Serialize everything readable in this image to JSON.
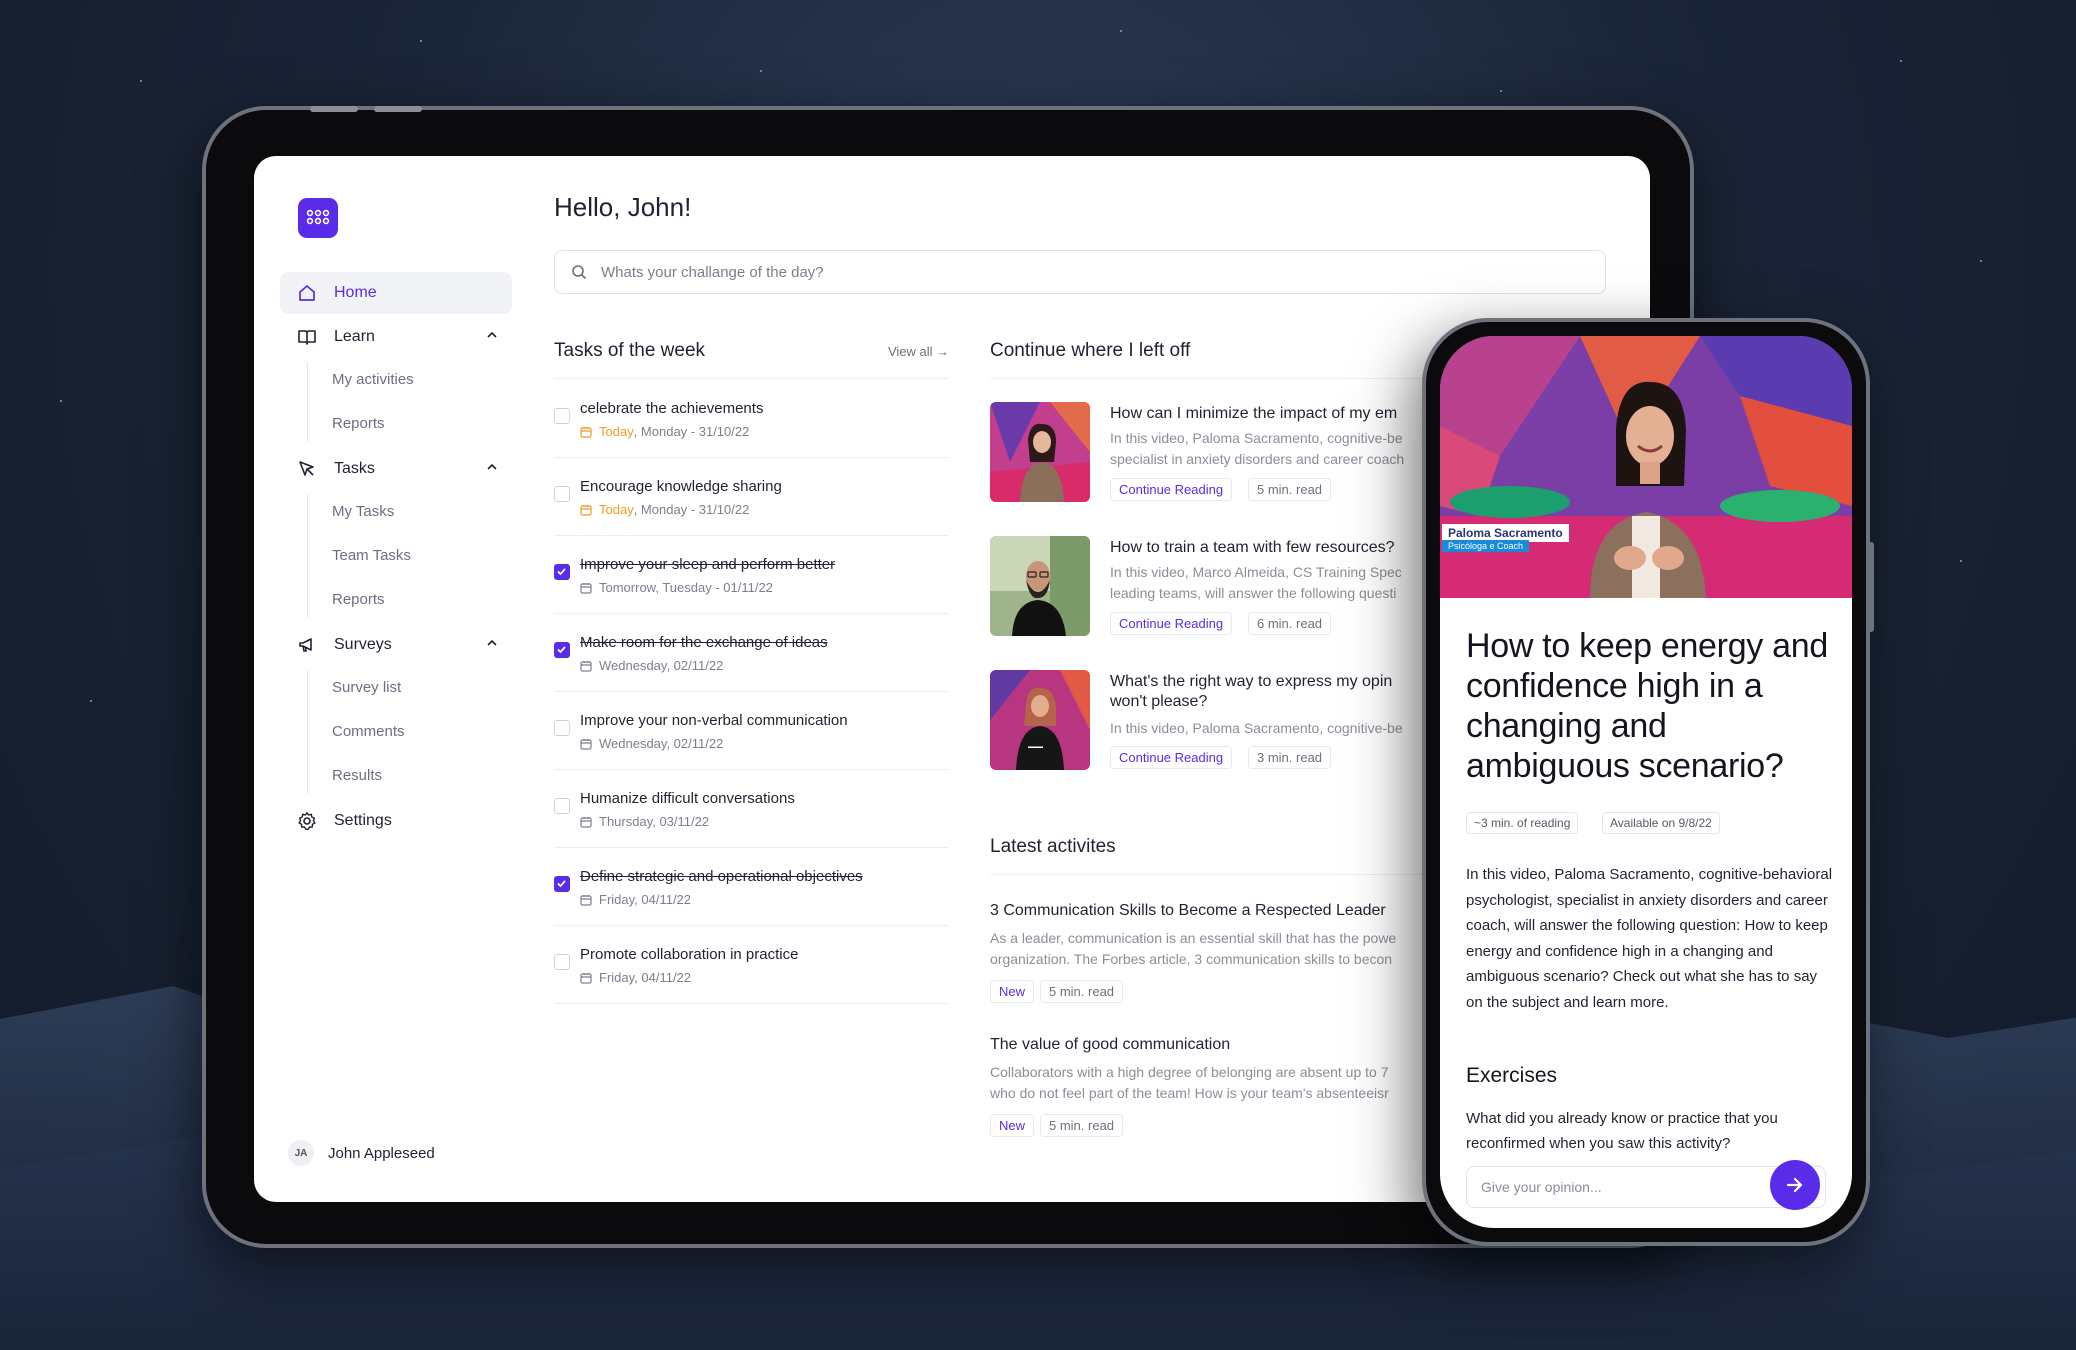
{
  "sidebar": {
    "items": [
      {
        "label": "Home",
        "icon": "home-icon"
      },
      {
        "label": "Learn",
        "icon": "book-icon",
        "sub": [
          "My activities",
          "Reports"
        ]
      },
      {
        "label": "Tasks",
        "icon": "cursor-icon",
        "sub": [
          "My Tasks",
          "Team Tasks",
          "Reports"
        ]
      },
      {
        "label": "Surveys",
        "icon": "megaphone-icon",
        "sub": [
          "Survey list",
          "Comments",
          "Results"
        ]
      },
      {
        "label": "Settings",
        "icon": "gear-icon"
      }
    ],
    "user": {
      "initials": "JA",
      "name": "John Appleseed"
    }
  },
  "header": {
    "greeting": "Hello, John!"
  },
  "search": {
    "placeholder": "Whats your challange of the day?"
  },
  "tasks": {
    "title": "Tasks of the week",
    "view_all": "View all →",
    "items": [
      {
        "title": "celebrate the achievements",
        "today": "Today",
        "date": ", Monday - 31/10/22",
        "done": false
      },
      {
        "title": "Encourage knowledge sharing",
        "today": "Today",
        "date": ", Monday - 31/10/22",
        "done": false
      },
      {
        "title": "Improve your sleep and perform better",
        "today": "",
        "date": "Tomorrow, Tuesday - 01/11/22",
        "done": true
      },
      {
        "title": "Make room for the exchange of ideas",
        "today": "",
        "date": "Wednesday, 02/11/22",
        "done": true
      },
      {
        "title": "Improve your non-verbal communication",
        "today": "",
        "date": "Wednesday, 02/11/22",
        "done": false
      },
      {
        "title": "Humanize difficult conversations",
        "today": "",
        "date": "Thursday, 03/11/22",
        "done": false
      },
      {
        "title": "Define strategic and operational objectives",
        "today": "",
        "date": "Friday, 04/11/22",
        "done": true
      },
      {
        "title": "Promote collaboration in practice",
        "today": "",
        "date": "Friday, 04/11/22",
        "done": false
      }
    ]
  },
  "continue": {
    "title": "Continue where I left off",
    "items": [
      {
        "title": "How can I minimize the impact of my em",
        "desc1": "In this video, Paloma Sacramento, cognitive-be",
        "desc2": "specialist in anxiety disorders and career coach",
        "link": "Continue Reading",
        "read": "5 min. read"
      },
      {
        "title": "How to train a team with few resources?",
        "desc1": "In this video, Marco Almeida, CS Training Spec",
        "desc2": "leading teams, will answer the following questi",
        "link": "Continue Reading",
        "read": "6 min. read"
      },
      {
        "title": "What's the right way to express my opin won't please?",
        "desc1": "In this video, Paloma Sacramento, cognitive-be",
        "desc2": "",
        "link": "Continue Reading",
        "read": "3 min. read"
      }
    ]
  },
  "latest": {
    "title": "Latest activites",
    "items": [
      {
        "title": "3 Communication Skills to Become a Respected Leader",
        "desc1": "As a leader, communication is an essential skill that has the powe",
        "desc2": "organization. The Forbes article, 3 communication skills to becon",
        "badge": "New",
        "read": "5 min. read"
      },
      {
        "title": "The value of good communication",
        "desc1": "Collaborators with a high degree of belonging are absent up to 7",
        "desc2": "who do not feel part of the team! How is your team's absenteeisr",
        "badge": "New",
        "read": "5 min. read"
      }
    ]
  },
  "phone": {
    "badge_name": "Paloma Sacramento",
    "badge_role": "Psicóloga e Coach",
    "title": "How to keep energy and confidence high in a changing and ambiguous scenario?",
    "reading": "~3 min. of reading",
    "available": "Available on 9/8/22",
    "description": "In this video, Paloma Sacramento, cognitive-behavioral psychologist, specialist in anxiety disorders and career coach, will answer the following question: How to keep energy and confidence high in a changing and ambiguous scenario? Check out what she has to say on the subject and learn more.",
    "exercises_title": "Exercises",
    "question": "What did you already know or practice that you reconfirmed when you saw this activity?",
    "input_placeholder": "Give your opinion..."
  },
  "colors": {
    "accent": "#5b2bea",
    "today": "#f19a24"
  }
}
